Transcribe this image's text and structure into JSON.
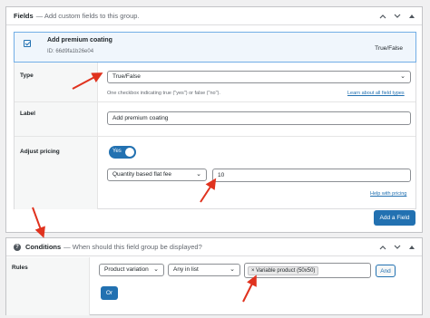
{
  "fields_panel": {
    "title": "Fields",
    "subtitle": "— Add custom fields to this group.",
    "field": {
      "label": "Add premium coating",
      "id": "ID: 66d9fa1b26e04",
      "type": "True/False"
    },
    "type_row": {
      "label": "Type",
      "value": "True/False",
      "hint": "One checkbox indicating true (\"yes\") or false (\"no\").",
      "link": "Learn about all field types"
    },
    "label_row": {
      "label": "Label",
      "value": "Add premium coating"
    },
    "pricing_row": {
      "label": "Adjust pricing",
      "toggle": "Yes",
      "toggle_on": true,
      "method": "Quantity based flat fee",
      "amount": "10",
      "help_link": "Help with pricing"
    },
    "add_button": "Add a Field"
  },
  "conditions_panel": {
    "title": "Conditions",
    "subtitle": "— When should this field group be displayed?",
    "rules_label": "Rules",
    "rule": {
      "param": "Product variation",
      "operator": "Any in list",
      "value_chip": "Variable product (50x50)"
    },
    "and_button": "And",
    "or_button": "Or"
  },
  "icons": {
    "collapse": "chevron-up-icon",
    "expand": "chevron-down-icon",
    "close": "close-icon",
    "help": "question-icon",
    "select": "chevron-down-icon",
    "annotation": "red-arrow-icon"
  },
  "colors": {
    "accent": "#2271b1",
    "annotation": "#e0321e",
    "selected_row": "#f0f6fc"
  }
}
